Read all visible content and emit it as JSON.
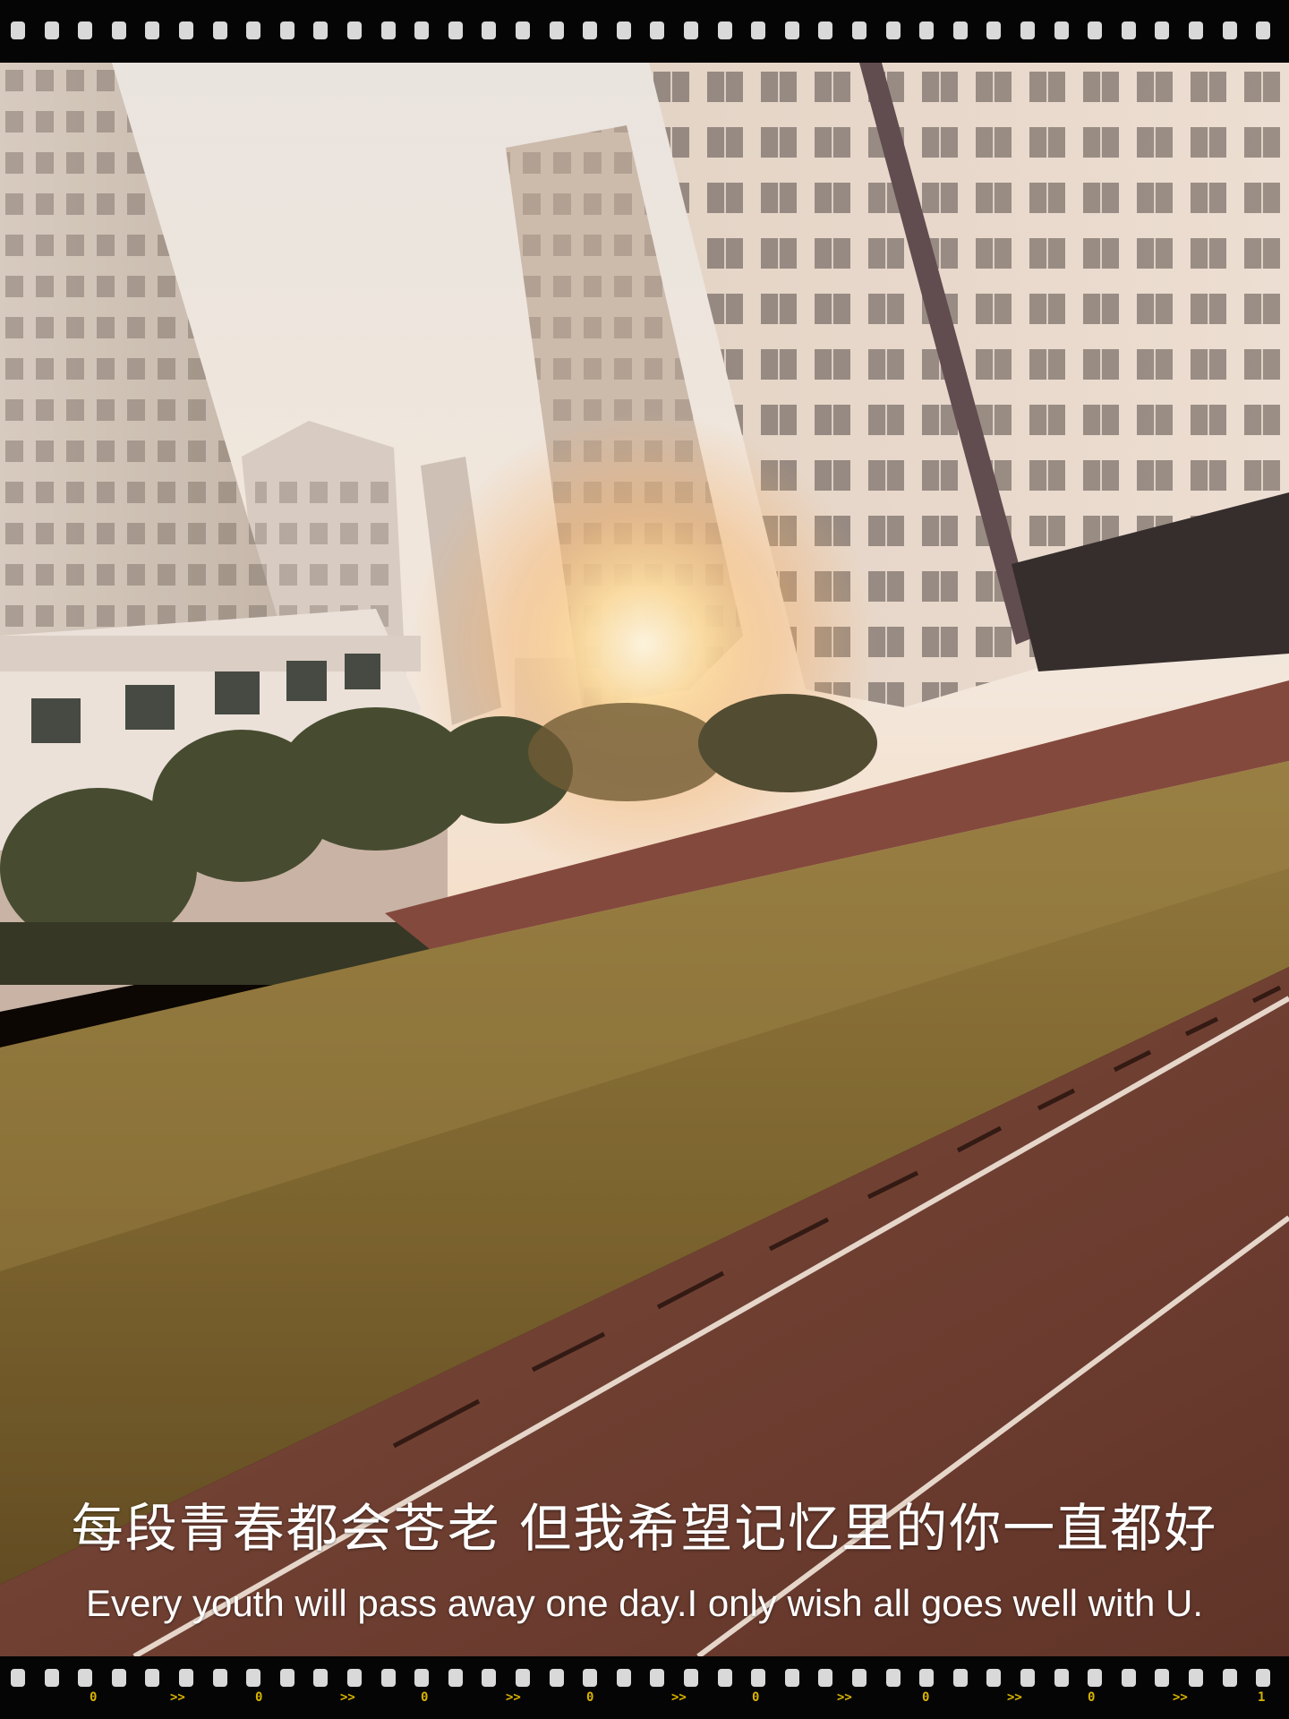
{
  "caption": {
    "chinese": "每段青春都会苍老  但我希望记忆里的你一直都好",
    "english": "Every youth will pass away one day.I only wish all goes well with U."
  },
  "film_strip": {
    "frame_markers": [
      "0",
      ">>",
      "0",
      ">>",
      "0",
      ">>",
      "0",
      ">>",
      "0",
      ">>",
      "0",
      ">>",
      "0",
      ">>",
      "1"
    ]
  },
  "colors": {
    "sky": "#f3ece9",
    "sun_glow": "#ffd58a",
    "grass": "#7a6630",
    "track": "#6e3e34",
    "film": "#050505",
    "perforation": "#d9d9d9",
    "marker": "#d9b300"
  }
}
